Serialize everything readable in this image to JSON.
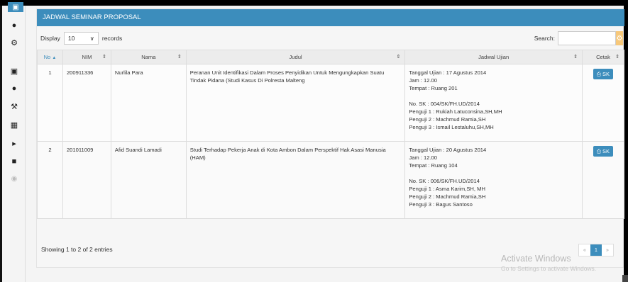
{
  "panel": {
    "title": "JADWAL SEMINAR PROPOSAL"
  },
  "controls": {
    "display_label": "Display",
    "page_size": "10",
    "records_label": "records",
    "search_label": "Search:",
    "search_placeholder": ""
  },
  "table": {
    "headers": {
      "no": "No",
      "nim": "NIM",
      "nama": "Nama",
      "judul": "Judul",
      "jadwal": "Jadwal Ujian",
      "cetak": "Cetak"
    },
    "rows": [
      {
        "no": "1",
        "nim": "200911336",
        "nama": "Nurlila Para",
        "judul": "Peranan Unit Identifikasi Dalam Proses Penyidikan Untuk Mengungkapkan Suatu Tindak Pidana (Studi Kasus Di Polresta Malteng",
        "tanggal": "Tanggal Ujian : 17 Agustus 2014",
        "jam": "Jam : 12.00",
        "tempat": "Tempat : Ruang 201",
        "no_sk": "No. SK : 004/SK/FH.UD/2014",
        "penguji1": "Penguji 1 : Rukiah Latuconsina,SH,MH",
        "penguji2": "Penguji 2 : Machmud Ramia,SH",
        "penguji3": "Penguji 3 : Ismail Lestaluhu,SH,MH",
        "button": "SK"
      },
      {
        "no": "2",
        "nim": "201011009",
        "nama": "Afid Suandi Lamadi",
        "judul": "Studi Terhadap Pekerja Anak di Kota Ambon Dalam Perspektif Hak Asasi Manusia (HAM)",
        "tanggal": "Tanggal Ujian : 20 Agustus 2014",
        "jam": "Jam : 12.00",
        "tempat": "Tempat : Ruang 104",
        "no_sk": "No. SK : 006/SK/FH.UD/2014",
        "penguji1": "Penguji 1 : Asma Karim,SH, MH",
        "penguji2": "Penguji 2 : Machmud Ramia,SH",
        "penguji3": "Penguji 3 : Bagus Santoso",
        "button": "SK"
      }
    ]
  },
  "footer": {
    "info": "Showing 1 to 2 of 2 entries"
  },
  "pagination": {
    "prev": "«",
    "current": "1",
    "next": "»"
  },
  "watermark": {
    "title": "Activate Windows",
    "subtitle": "Go to Settings to activate Windows."
  },
  "colors": {
    "accent": "#3c8dbc",
    "warning": "#f7c87a"
  }
}
